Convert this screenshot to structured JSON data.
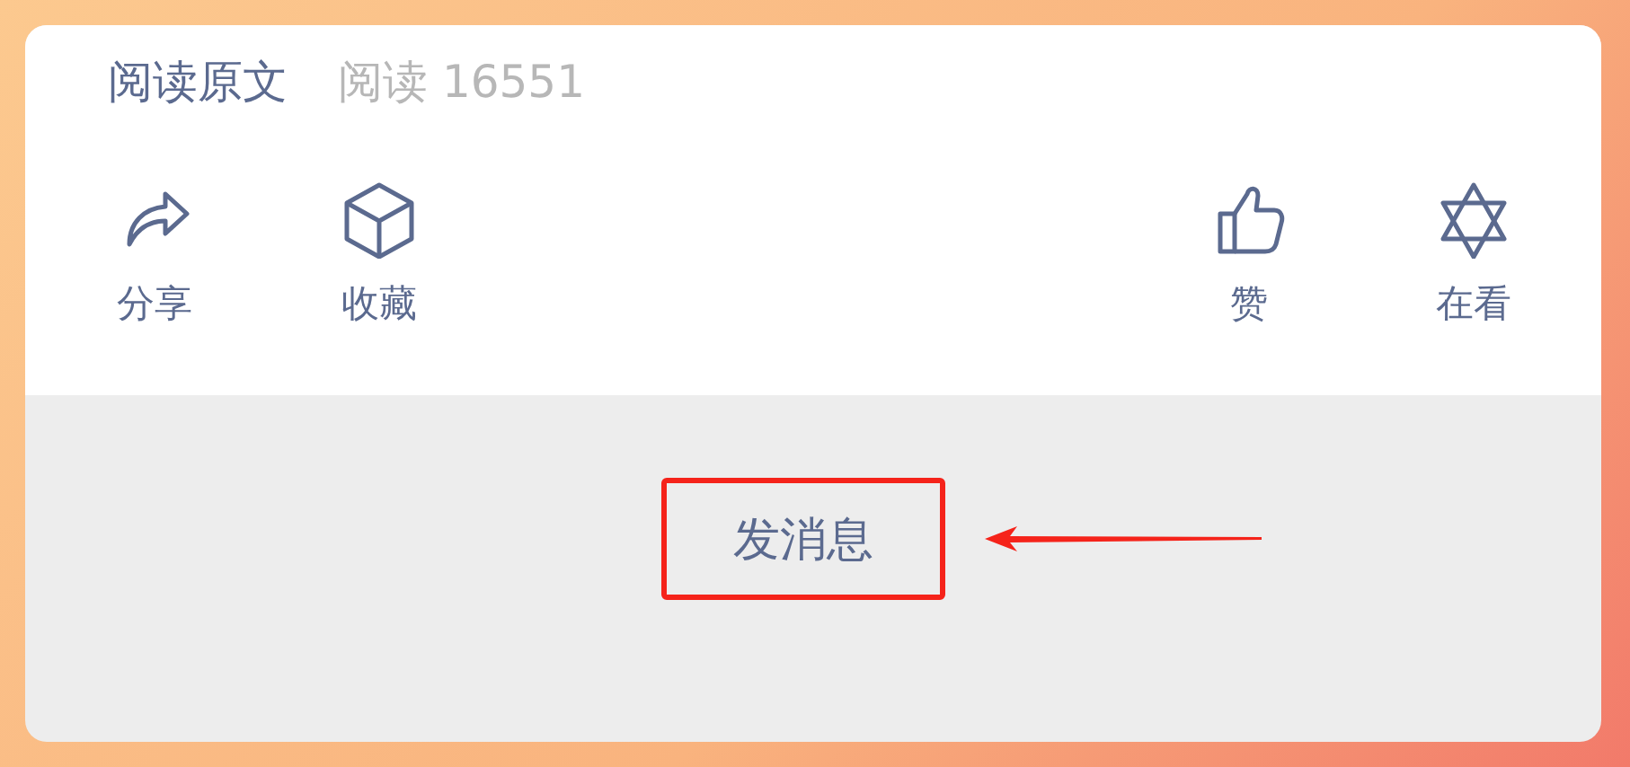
{
  "header": {
    "link": "阅读原文",
    "read_count": "阅读 16551"
  },
  "actions": [
    {
      "kind": "share",
      "label": "分享"
    },
    {
      "kind": "collect",
      "label": "收藏"
    },
    {
      "kind": "like",
      "label": "赞"
    },
    {
      "kind": "watching",
      "label": "在看"
    }
  ],
  "message_button": {
    "label": "发消息"
  }
}
